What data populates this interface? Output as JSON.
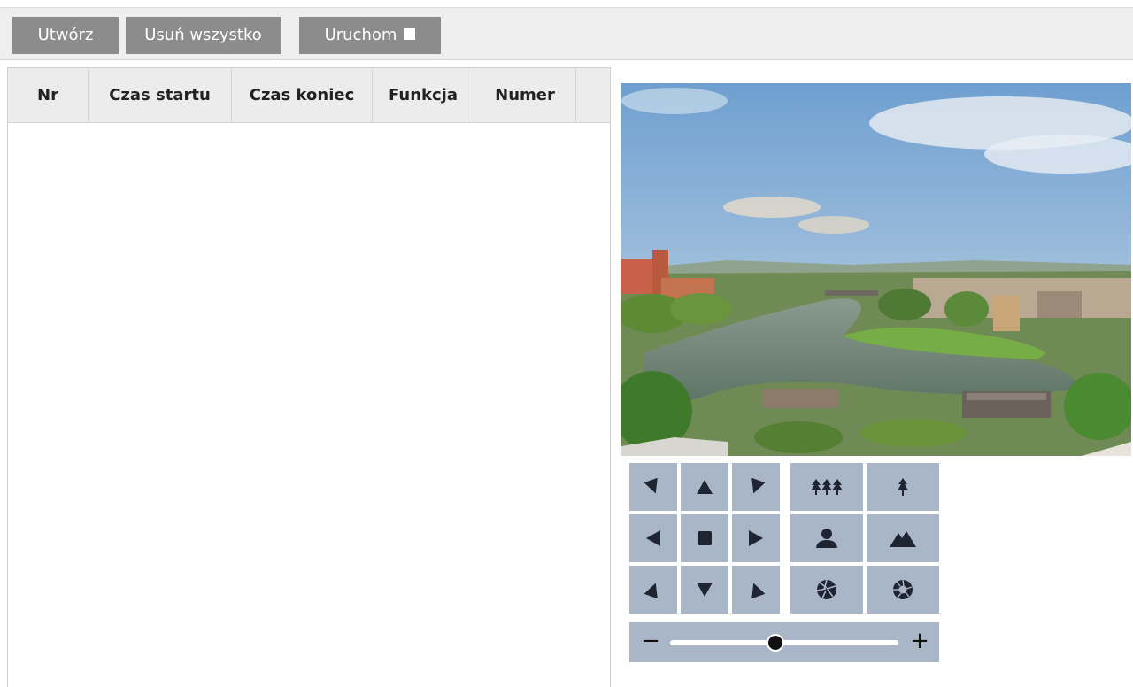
{
  "toolbar": {
    "create_label": "Utwórz",
    "delete_all_label": "Usuń wszystko",
    "run_label": "Uruchom"
  },
  "table": {
    "columns": [
      "Nr",
      "Czas startu",
      "Czas koniec",
      "Funkcja",
      "Numer"
    ],
    "rows": []
  },
  "ptz": {
    "directions": [
      "up-left",
      "up",
      "up-right",
      "left",
      "stop",
      "right",
      "down-left",
      "down",
      "down-right"
    ],
    "lens_controls": [
      "focus-far",
      "focus-near",
      "zoom-portrait",
      "zoom-landscape",
      "iris-open",
      "iris-close"
    ],
    "zoom_slider": {
      "min_label": "−",
      "max_label": "+",
      "value_fraction": 0.46
    }
  },
  "colors": {
    "toolbar_button": "#8c8c8c",
    "control_background": "#a9b6c7",
    "icon": "#1f2433"
  }
}
